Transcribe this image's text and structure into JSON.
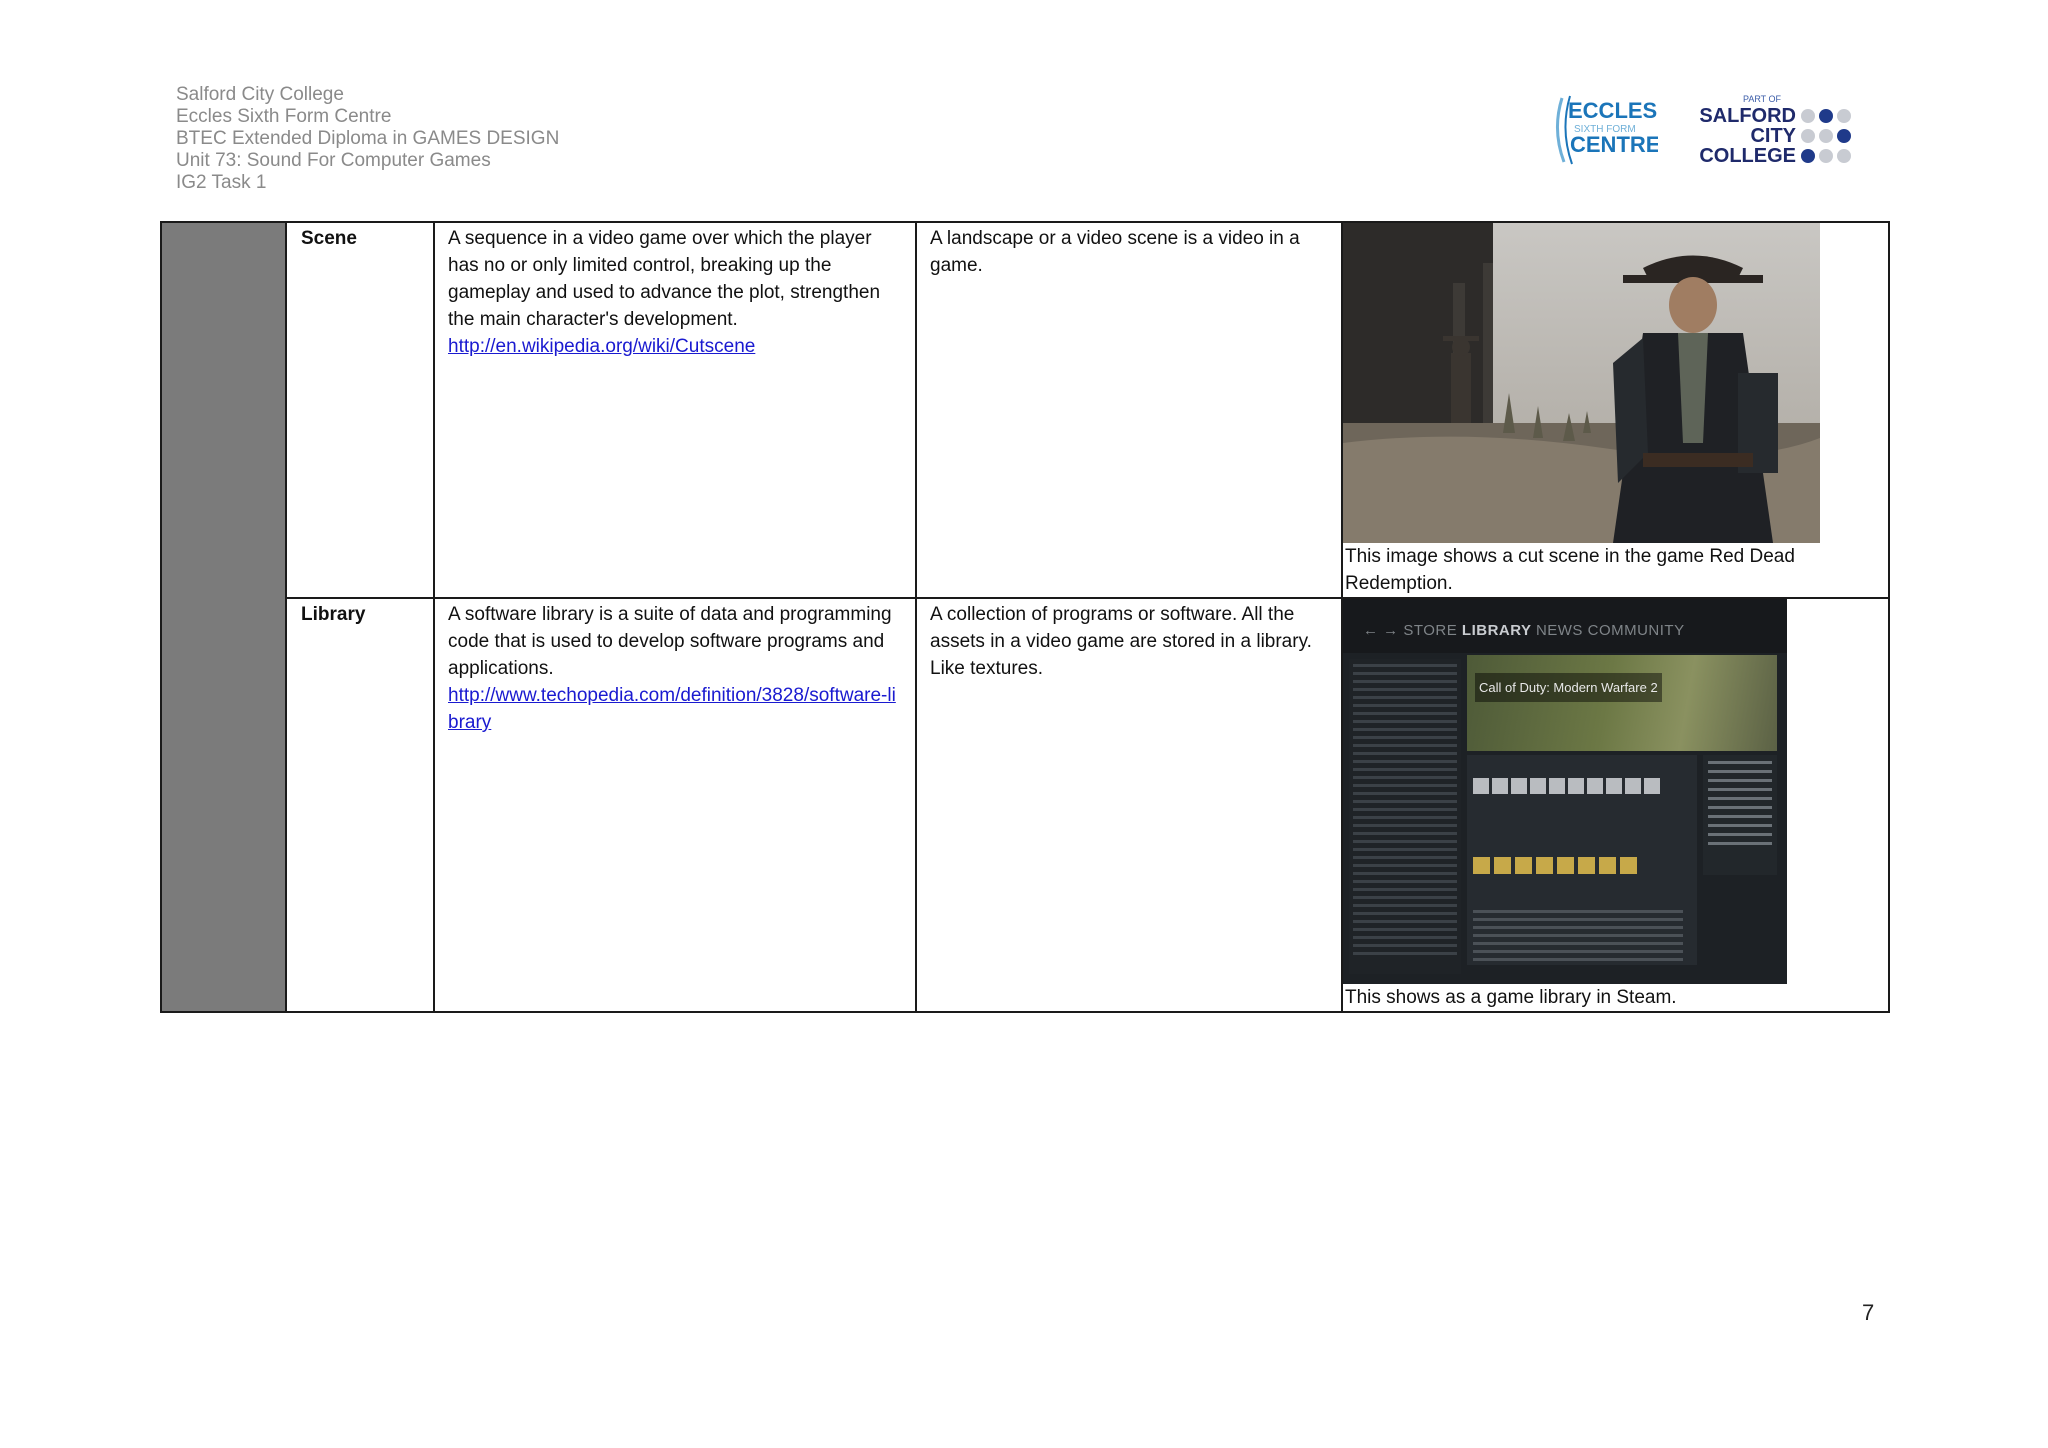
{
  "header": {
    "lines": [
      "Salford City College",
      "Eccles Sixth Form Centre",
      "BTEC Extended Diploma  in GAMES DESIGN",
      "Unit 73: Sound For Computer Games",
      "IG2 Task 1"
    ],
    "logo_eccles": {
      "line1": "ECCLES",
      "line2": "SIXTH FORM",
      "line3": "CENTRE"
    },
    "logo_salford": {
      "top": "PART OF",
      "line1": "SALFORD",
      "line2": "CITY",
      "line3": "COLLEGE"
    }
  },
  "rows": [
    {
      "term": "Scene",
      "definition": "A sequence in a video game over which the player has no or only limited control, breaking up the gameplay and used to advance the plot, strengthen the main character's development.",
      "link": "http://en.wikipedia.org/wiki/Cutscene",
      "own_words": "A landscape or a video scene is a video in a game.",
      "caption": "This image shows a cut scene in the game Red Dead Redemption."
    },
    {
      "term": "Library",
      "definition": "A software library is a suite of data and programming code that is used to develop software programs and applications.",
      "link": "http://www.techopedia.com/definition/3828/software-library",
      "own_words": "A collection of programs or software. All the assets in a video game are stored in a library. Like textures.",
      "caption": "This shows as a game library in Steam.",
      "screenshot": {
        "nav_store": "STORE",
        "nav_library": "LIBRARY",
        "nav_news": "NEWS",
        "nav_community": "COMMUNITY",
        "game_title": "Call of Duty: Modern Warfare 2"
      }
    }
  ],
  "page_number": "7",
  "colors": {
    "header_grey": "#8a8a8a",
    "side_bar": "#7b7b7b",
    "link": "#1a1ad0",
    "eccles_blue": "#1b75b9",
    "salford_navy": "#1f2a6b"
  }
}
